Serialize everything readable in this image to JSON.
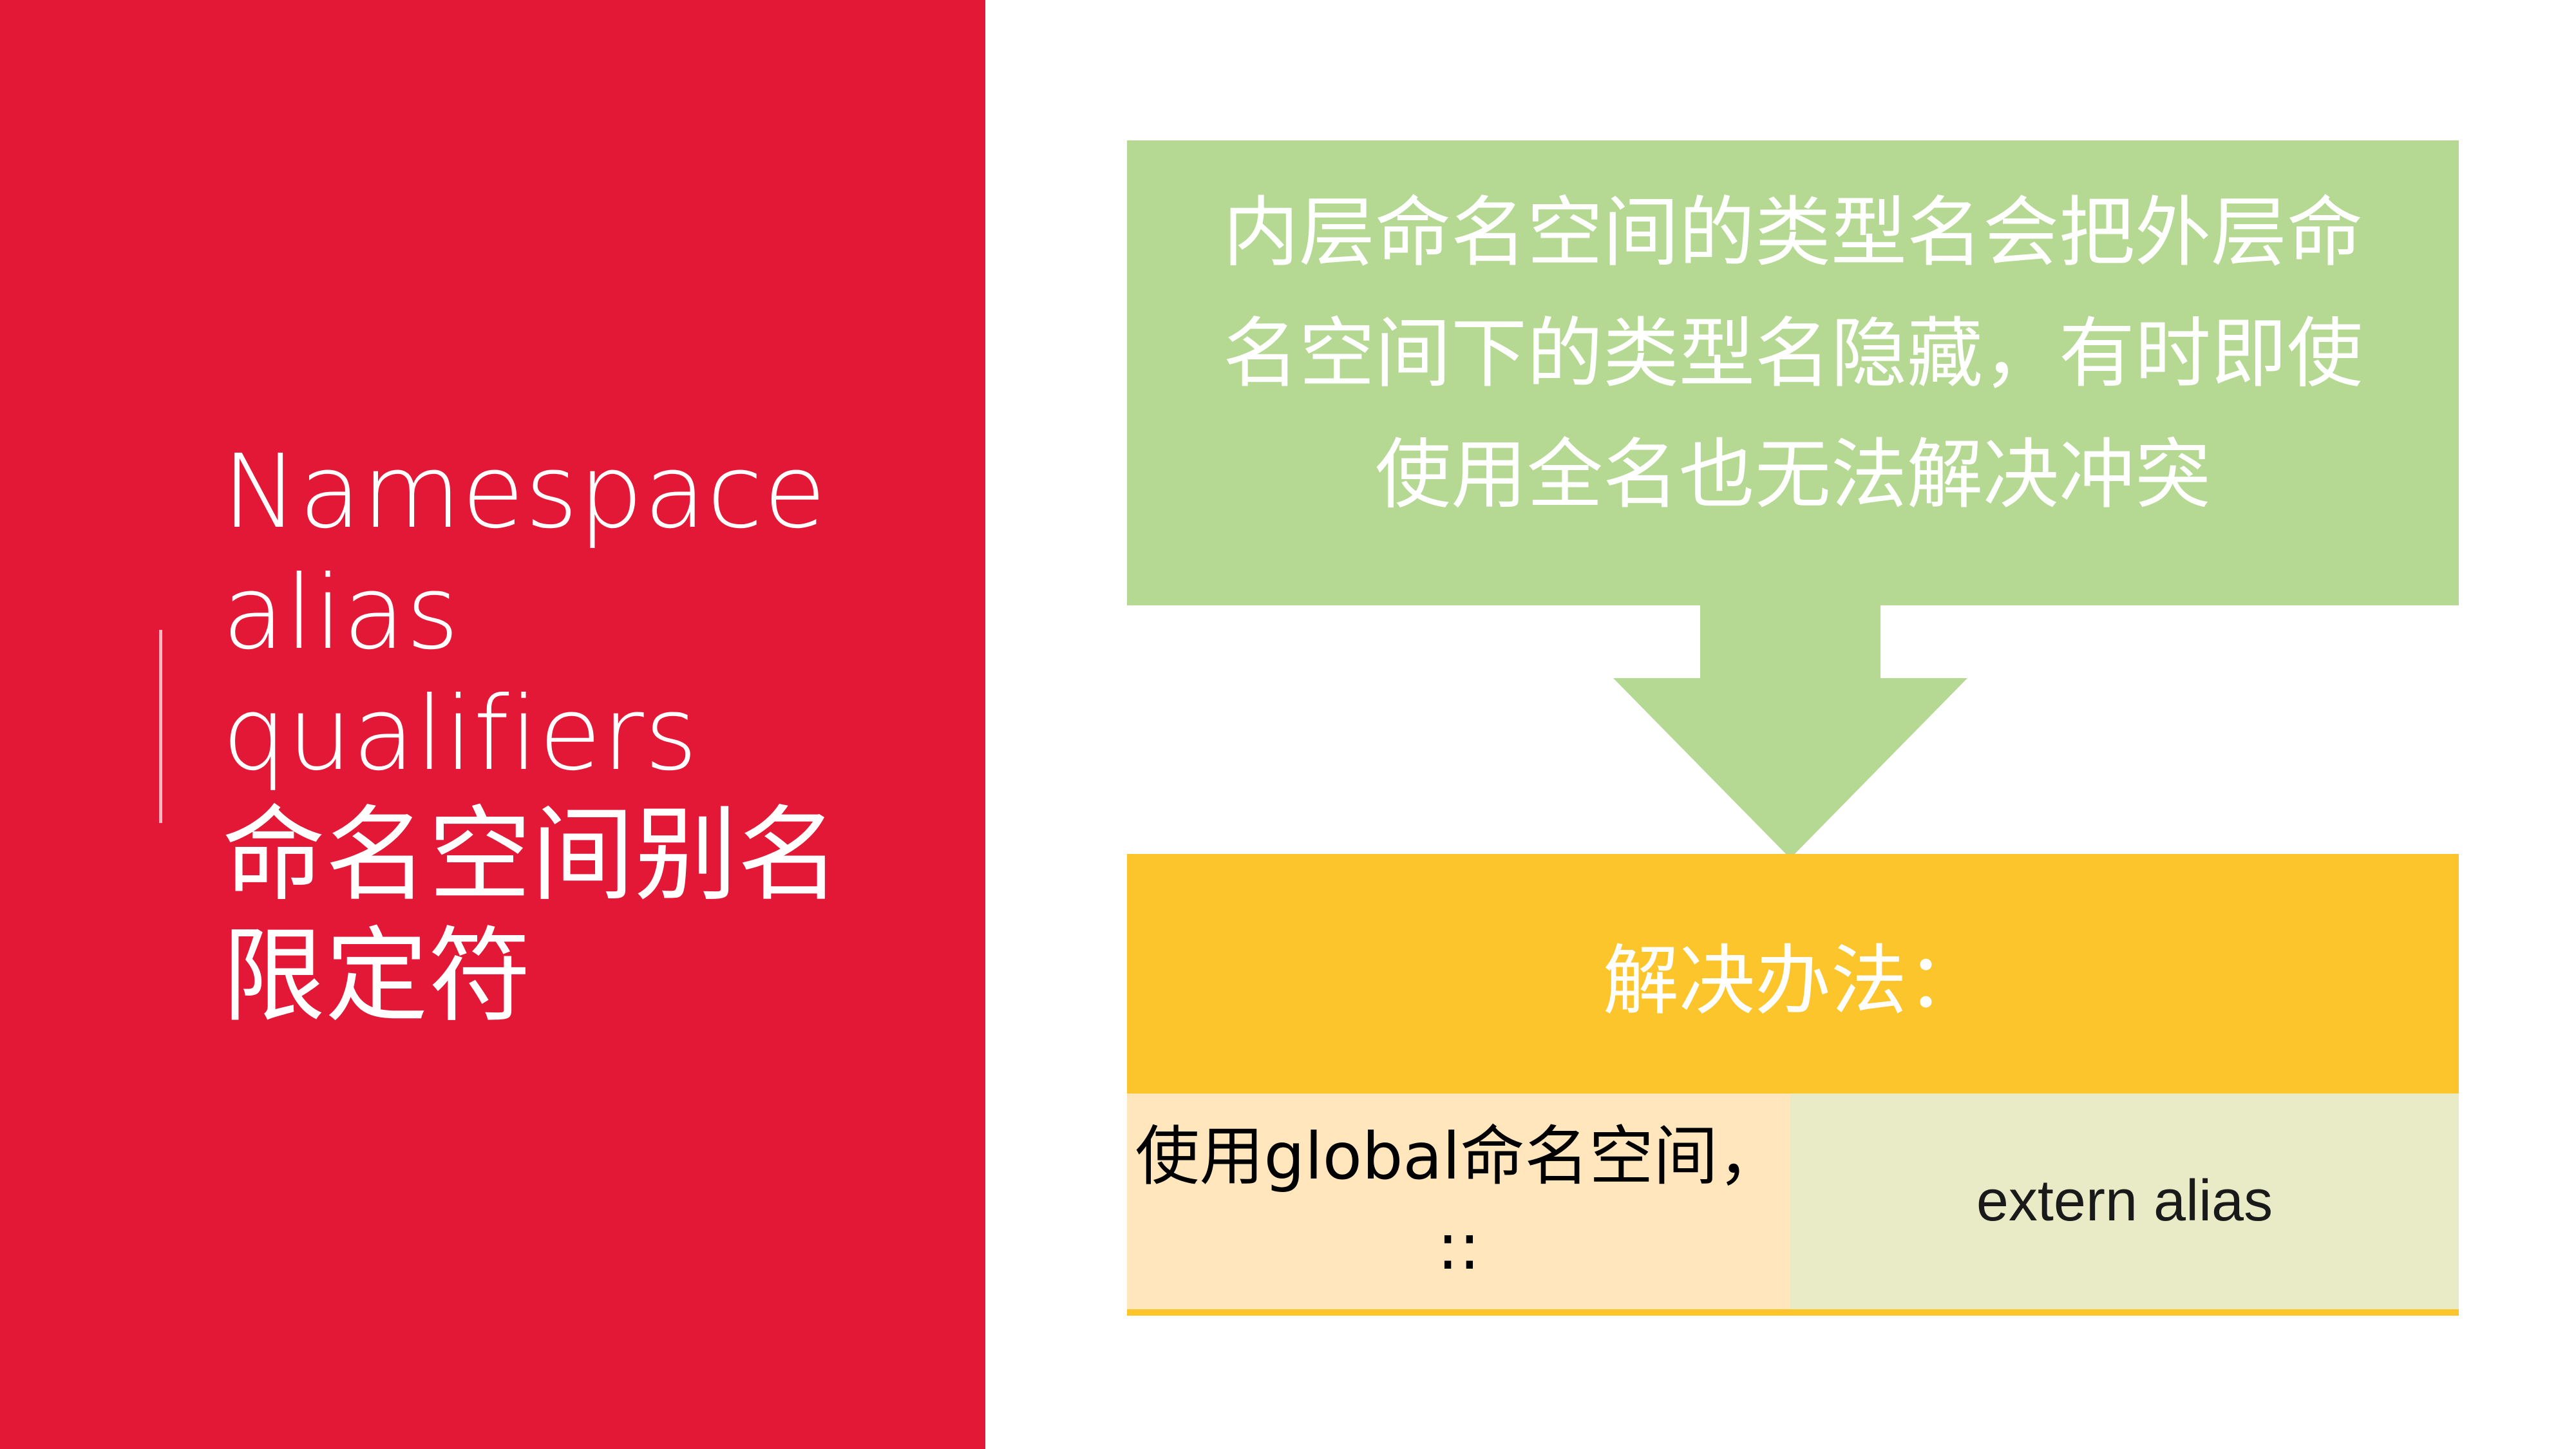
{
  "title": {
    "en_line1": "Namespace",
    "en_line2": "alias",
    "en_line3": "qualifiers",
    "zh_line1": "命名空间别名",
    "zh_line2": "限定符"
  },
  "problem": {
    "text": "内层命名空间的类型名会把外层命名空间下的类型名隐藏，有时即使使用全名也无法解决冲突"
  },
  "solution": {
    "header": "解决办法：",
    "option_global_line1": "使用global命名空间，",
    "option_global_line2": "::",
    "option_extern": "extern alias"
  },
  "colors": {
    "left_panel": "#E31837",
    "problem_box": "#B5D993",
    "solution_header": "#FDC52C",
    "cell_global": "#FFE6BC",
    "cell_extern": "#E9EBC7"
  }
}
